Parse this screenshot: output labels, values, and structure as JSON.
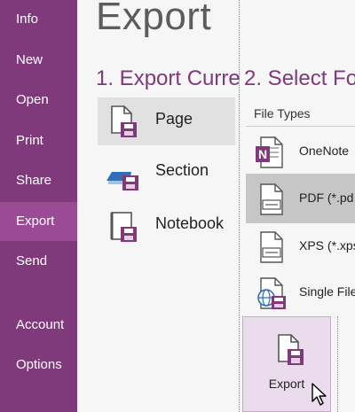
{
  "sidebar": {
    "items": [
      {
        "label": "Info",
        "active": false
      },
      {
        "label": "New",
        "active": false
      },
      {
        "label": "Open",
        "active": false
      },
      {
        "label": "Print",
        "active": false
      },
      {
        "label": "Share",
        "active": false
      },
      {
        "label": "Export",
        "active": true
      },
      {
        "label": "Send",
        "active": false
      },
      {
        "label": "Account",
        "active": false
      },
      {
        "label": "Options",
        "active": false
      }
    ]
  },
  "page": {
    "title": "Export"
  },
  "scope_section": {
    "heading": "1. Export Curre",
    "items": [
      {
        "label": "Page",
        "icon": "page-export-icon",
        "selected": true
      },
      {
        "label": "Section",
        "icon": "section-export-icon",
        "selected": false
      },
      {
        "label": "Notebook",
        "icon": "notebook-export-icon",
        "selected": false
      }
    ]
  },
  "format_section": {
    "heading": "2. Select Fo",
    "file_types_label": "File Types",
    "items": [
      {
        "label": "OneNote",
        "icon": "onenote-file-icon",
        "selected": false
      },
      {
        "label": "PDF (*.pd",
        "icon": "pdf-file-icon",
        "selected": true
      },
      {
        "label": "XPS (*.xps",
        "icon": "xps-file-icon",
        "selected": false
      },
      {
        "label": "Single File",
        "icon": "web-file-icon",
        "selected": false
      }
    ]
  },
  "export_button": {
    "label": "Export"
  },
  "colors": {
    "sidebar": "#80397b",
    "sidebar_active": "#9b4b95",
    "accent_text": "#80397b",
    "selected_scope": "#e1e1e1",
    "selected_filetype": "#c6c6c6",
    "export_button_bg": "#eadcec"
  }
}
